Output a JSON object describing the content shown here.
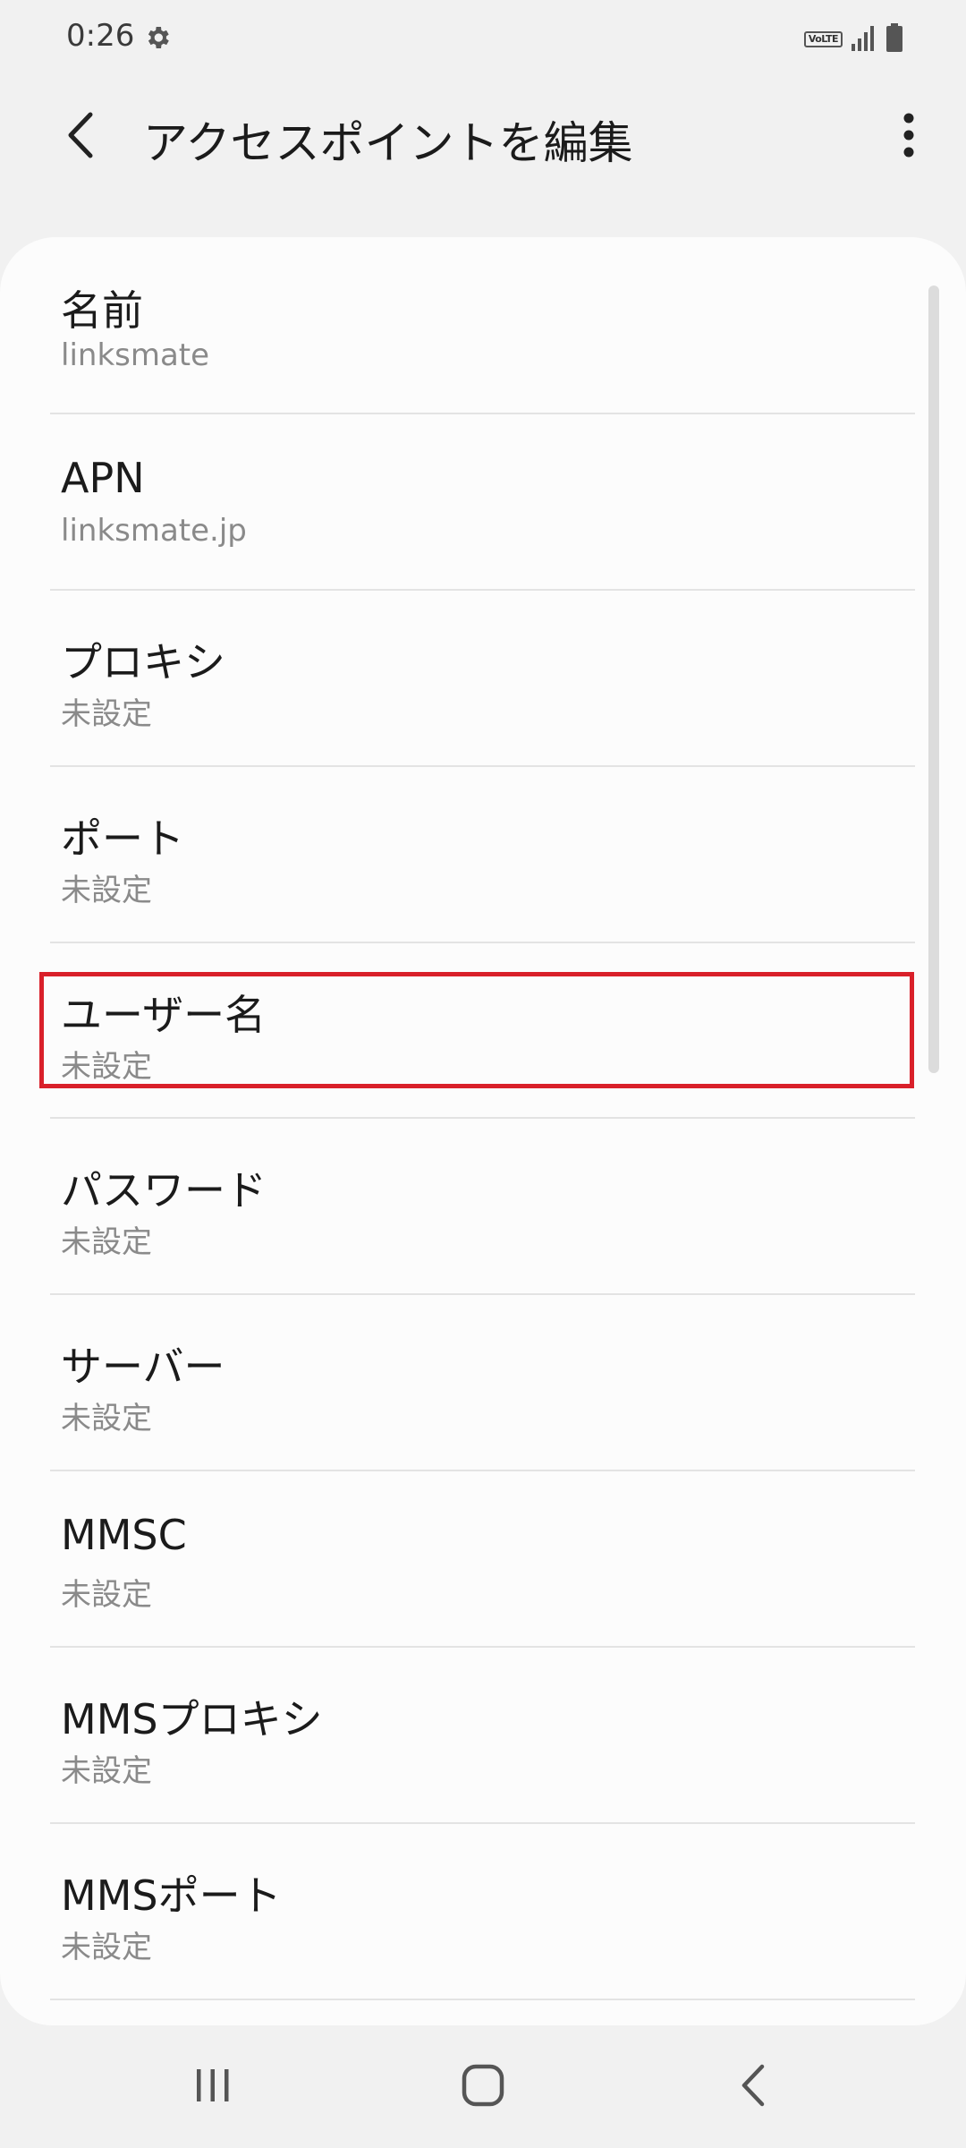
{
  "status_bar": {
    "time": "0:26",
    "volte": "VoLTE",
    "icons": [
      "gear-icon",
      "signal-icon",
      "battery-icon"
    ]
  },
  "header": {
    "title": "アクセスポイントを編集",
    "icons": [
      "back-arrow-icon",
      "more-vertical-icon"
    ]
  },
  "apn_fields": [
    {
      "label": "名前",
      "value": "linksmate"
    },
    {
      "label": "APN",
      "value": "linksmate.jp"
    },
    {
      "label": "プロキシ",
      "value": "未設定"
    },
    {
      "label": "ポート",
      "value": "未設定"
    },
    {
      "label": "ユーザー名",
      "value": "未設定"
    },
    {
      "label": "パスワード",
      "value": "未設定"
    },
    {
      "label": "サーバー",
      "value": "未設定"
    },
    {
      "label": "MMSC",
      "value": "未設定"
    },
    {
      "label": "MMSプロキシ",
      "value": "未設定"
    },
    {
      "label": "MMSポート",
      "value": "未設定"
    }
  ],
  "highlight": {
    "target": "ユーザー名",
    "color": "#d9202a"
  },
  "nav_bar": {
    "icons": [
      "recents-icon",
      "home-icon",
      "back-icon"
    ]
  },
  "colors": {
    "background": "#f1f1f1",
    "card": "#fcfcfc",
    "secondary_text": "#8a8a8a"
  }
}
